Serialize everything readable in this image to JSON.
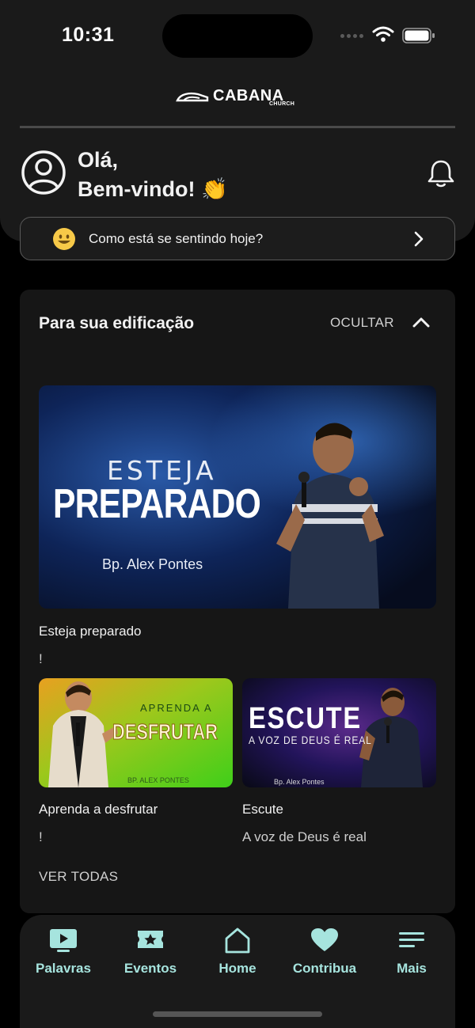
{
  "status_bar": {
    "time": "10:31"
  },
  "header": {
    "brand": "CABANA",
    "brand_sub": "CHURCH",
    "greeting_line1": "Olá,",
    "greeting_line2": "Bem-vindo! 👏",
    "mood_prompt": "Como está se sentindo hoje?"
  },
  "edification": {
    "title": "Para sua edificação",
    "hide_label": "OCULTAR",
    "see_all_label": "VER TODAS",
    "featured": {
      "art_line1": "ESTEJA",
      "art_line2": "PREPARADO",
      "art_speaker": "Bp. Alex Pontes",
      "title": "Esteja preparado",
      "subtitle": "!"
    },
    "items": [
      {
        "art_line1": "APRENDA A",
        "art_line2": "DESFRUTAR",
        "art_speaker": "BP. ALEX PONTES",
        "title": "Aprenda a desfrutar",
        "subtitle": "!"
      },
      {
        "art_line1": "ESCUTE",
        "art_line2": "A VOZ DE DEUS É REAL",
        "art_speaker": "Bp. Alex Pontes",
        "title": "Escute",
        "subtitle": "A voz de Deus é real"
      }
    ]
  },
  "tabs": [
    {
      "label": "Palavras",
      "icon": "play-screen-icon"
    },
    {
      "label": "Eventos",
      "icon": "ticket-star-icon"
    },
    {
      "label": "Home",
      "icon": "home-icon"
    },
    {
      "label": "Contribua",
      "icon": "heart-icon"
    },
    {
      "label": "Mais",
      "icon": "menu-icon"
    }
  ],
  "colors": {
    "accent": "#a6e4de",
    "background": "#000000",
    "card": "#161616"
  }
}
